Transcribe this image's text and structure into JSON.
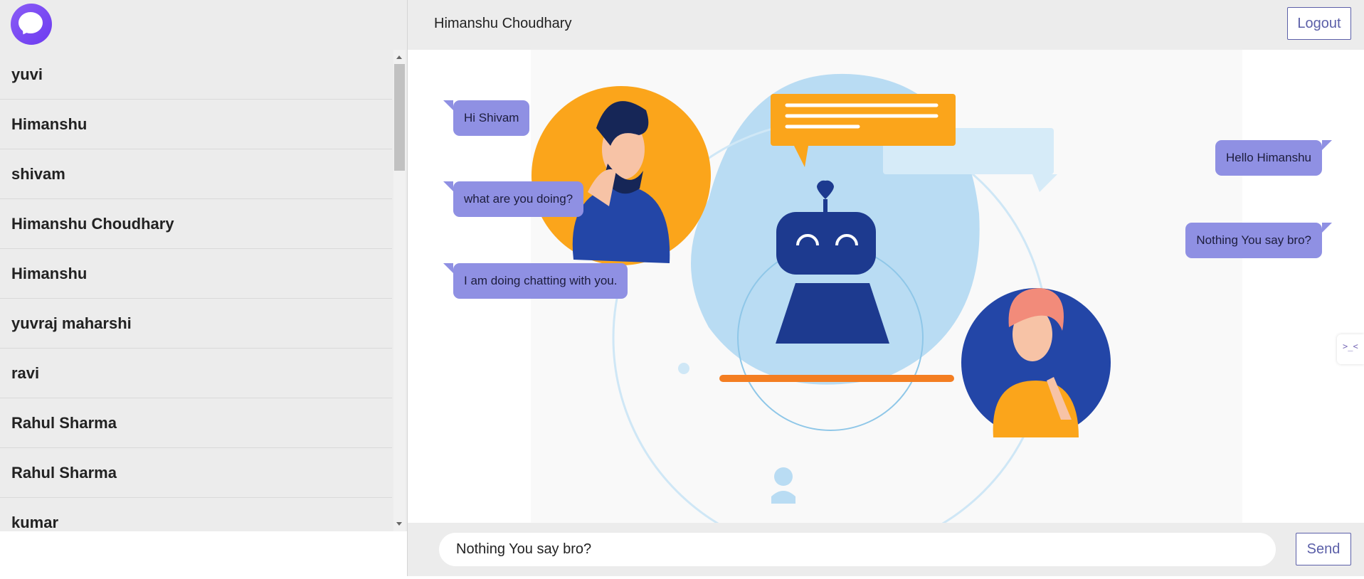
{
  "sidebar": {
    "logo_icon": "chat-bubble-logo",
    "users": [
      {
        "name": "yuvi"
      },
      {
        "name": "Himanshu"
      },
      {
        "name": "shivam"
      },
      {
        "name": "Himanshu Choudhary"
      },
      {
        "name": "Himanshu"
      },
      {
        "name": "yuvraj maharshi"
      },
      {
        "name": "ravi"
      },
      {
        "name": "Rahul Sharma"
      },
      {
        "name": "Rahul Sharma"
      },
      {
        "name": "kumar"
      }
    ]
  },
  "header": {
    "chat_title": "Himanshu Choudhary",
    "logout_label": "Logout"
  },
  "messages": {
    "received": [
      {
        "text": "Hi Shivam"
      },
      {
        "text": "what are you doing?"
      },
      {
        "text": "I am doing chatting with you."
      }
    ],
    "sent": [
      {
        "text": "Hello Himanshu"
      },
      {
        "text": "Nothing You say bro?"
      }
    ]
  },
  "composer": {
    "input_value": "Nothing You say bro?",
    "send_label": "Send"
  },
  "side_widget": {
    "glyph": ">_<"
  },
  "colors": {
    "accent": "#5b5fa8",
    "bubble": "#8f90e3",
    "logo": "#7b47f3",
    "panel": "#ececec"
  }
}
